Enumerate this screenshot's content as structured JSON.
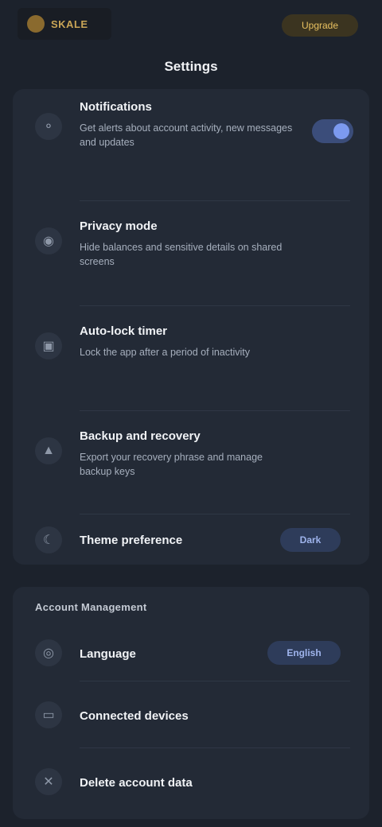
{
  "header": {
    "brand": "SKALE",
    "action_label": "Upgrade",
    "title": "Settings"
  },
  "settings": {
    "items": [
      {
        "title": "Notifications",
        "description": "Get alerts about account activity, new messages and updates",
        "icon": "bell-icon",
        "control": "toggle",
        "toggle_on": true
      },
      {
        "title": "Privacy mode",
        "description": "Hide balances and sensitive details on shared screens",
        "icon": "eye-icon"
      },
      {
        "title": "Auto-lock timer",
        "description": "Lock the app after a period of inactivity",
        "icon": "lock-icon"
      },
      {
        "title": "Backup and recovery",
        "description": "Export your recovery phrase and manage backup keys",
        "icon": "shield-icon"
      },
      {
        "title": "Theme preference",
        "icon": "moon-icon",
        "action_label": "Dark"
      }
    ]
  },
  "account": {
    "section_title": "Account Management",
    "items": [
      {
        "title": "Language",
        "icon": "globe-icon",
        "action_label": "English"
      },
      {
        "title": "Connected devices",
        "icon": "device-icon"
      },
      {
        "title": "Delete account data",
        "icon": "trash-icon"
      }
    ]
  },
  "colors": {
    "background": "#1c222c",
    "card": "#232a36",
    "accent": "#7c9af0",
    "brand_gold": "#c9a556"
  }
}
